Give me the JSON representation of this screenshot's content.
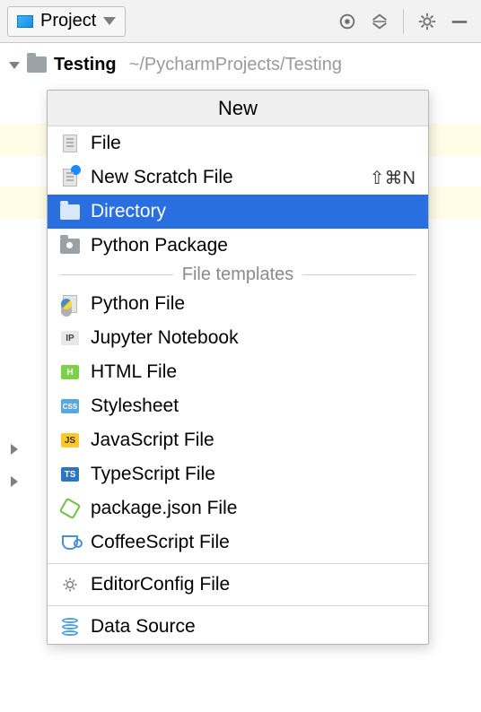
{
  "toolbar": {
    "view_label": "Project"
  },
  "tree": {
    "root_name": "Testing",
    "root_path": "~/PycharmProjects/Testing"
  },
  "menu": {
    "header": "New",
    "items_top": [
      {
        "label": "File",
        "shortcut": ""
      },
      {
        "label": "New Scratch File",
        "shortcut": "⇧⌘N"
      },
      {
        "label": "Directory",
        "shortcut": "",
        "selected": true
      },
      {
        "label": "Python Package",
        "shortcut": ""
      }
    ],
    "section_label": "File templates",
    "items_templates": [
      {
        "label": "Python File"
      },
      {
        "label": "Jupyter Notebook"
      },
      {
        "label": "HTML File"
      },
      {
        "label": "Stylesheet"
      },
      {
        "label": "JavaScript File"
      },
      {
        "label": "TypeScript File"
      },
      {
        "label": "package.json File"
      },
      {
        "label": "CoffeeScript File"
      }
    ],
    "items_bottom": [
      {
        "label": "EditorConfig File"
      },
      {
        "label": "Data Source"
      }
    ]
  }
}
